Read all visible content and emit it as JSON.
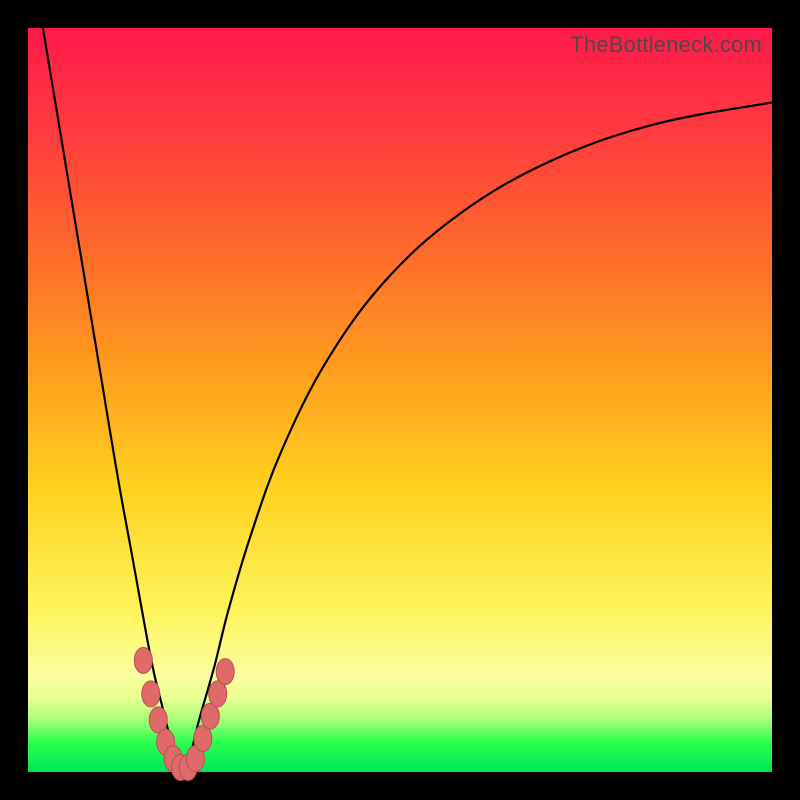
{
  "watermark": "TheBottleneck.com",
  "colors": {
    "frame": "#000000",
    "gradient_top": "#ff1a4a",
    "gradient_mid": "#ffd21f",
    "gradient_bottom": "#00e65a",
    "curve": "#000000",
    "bead_fill": "#e06a6a",
    "bead_stroke": "#b84f4f"
  },
  "chart_data": {
    "type": "line",
    "title": "",
    "xlabel": "",
    "ylabel": "",
    "xlim": [
      0,
      100
    ],
    "ylim": [
      0,
      100
    ],
    "series": [
      {
        "name": "left-branch",
        "x": [
          2,
          4,
          6,
          8,
          10,
          12,
          14,
          16,
          17,
          18,
          19,
          20,
          21
        ],
        "y": [
          100,
          88,
          76,
          64,
          52,
          40,
          29,
          18,
          13,
          9,
          5,
          2,
          0
        ]
      },
      {
        "name": "right-branch",
        "x": [
          21,
          22,
          23,
          25,
          27,
          30,
          34,
          40,
          48,
          58,
          70,
          84,
          100
        ],
        "y": [
          0,
          3,
          7,
          14,
          22,
          32,
          43,
          55,
          66,
          75,
          82,
          87,
          90
        ]
      }
    ],
    "markers": [
      {
        "x": 15.5,
        "y": 15.0
      },
      {
        "x": 16.5,
        "y": 10.5
      },
      {
        "x": 17.5,
        "y": 7.0
      },
      {
        "x": 18.5,
        "y": 4.0
      },
      {
        "x": 19.5,
        "y": 1.8
      },
      {
        "x": 20.5,
        "y": 0.6
      },
      {
        "x": 21.5,
        "y": 0.6
      },
      {
        "x": 22.5,
        "y": 1.8
      },
      {
        "x": 23.5,
        "y": 4.5
      },
      {
        "x": 24.5,
        "y": 7.5
      },
      {
        "x": 25.5,
        "y": 10.5
      },
      {
        "x": 26.5,
        "y": 13.5
      }
    ],
    "grid": false,
    "legend": false
  }
}
